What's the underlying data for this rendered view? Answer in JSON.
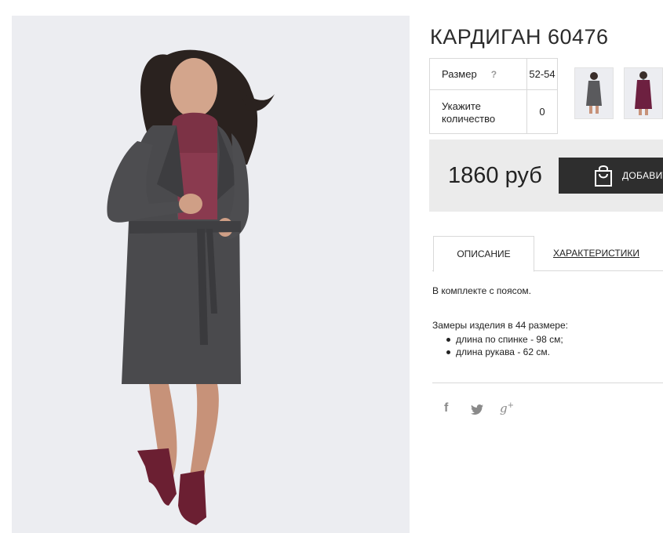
{
  "product": {
    "title": "КАРДИГАН 60476",
    "image_alt": "product photo: woman in grey wrap cardigan with burgundy turtleneck"
  },
  "options": {
    "size_label": "Размер",
    "size_help": "?",
    "size_value": "52-54",
    "qty_label_line1": "Укажите",
    "qty_label_line2": "количество",
    "qty_value": "0"
  },
  "thumbnails": [
    {
      "name": "grey"
    },
    {
      "name": "burgundy"
    }
  ],
  "price": {
    "amount": "1860 руб",
    "cart_button": "ДОБАВИТЬ В КОРЗИНУ"
  },
  "tabs": [
    {
      "label": "ОПИСАНИЕ",
      "active": true
    },
    {
      "label": "ХАРАКТЕРИСТИКИ",
      "active": false
    }
  ],
  "description": {
    "line1": "В комплекте с поясом.",
    "line2": "Замеры изделия в 44 размере:",
    "bullets": [
      "длина по спинке - 98 см;",
      "длина рукава - 62 см."
    ]
  },
  "social": {
    "facebook": "f",
    "twitter": "twitter-icon",
    "gplus": "g",
    "gplus_sup": "+"
  },
  "colors": {
    "accent_dark": "#2e2e2e",
    "price_box_bg": "#ebebeb",
    "photo_bg": "#ecedf1"
  }
}
